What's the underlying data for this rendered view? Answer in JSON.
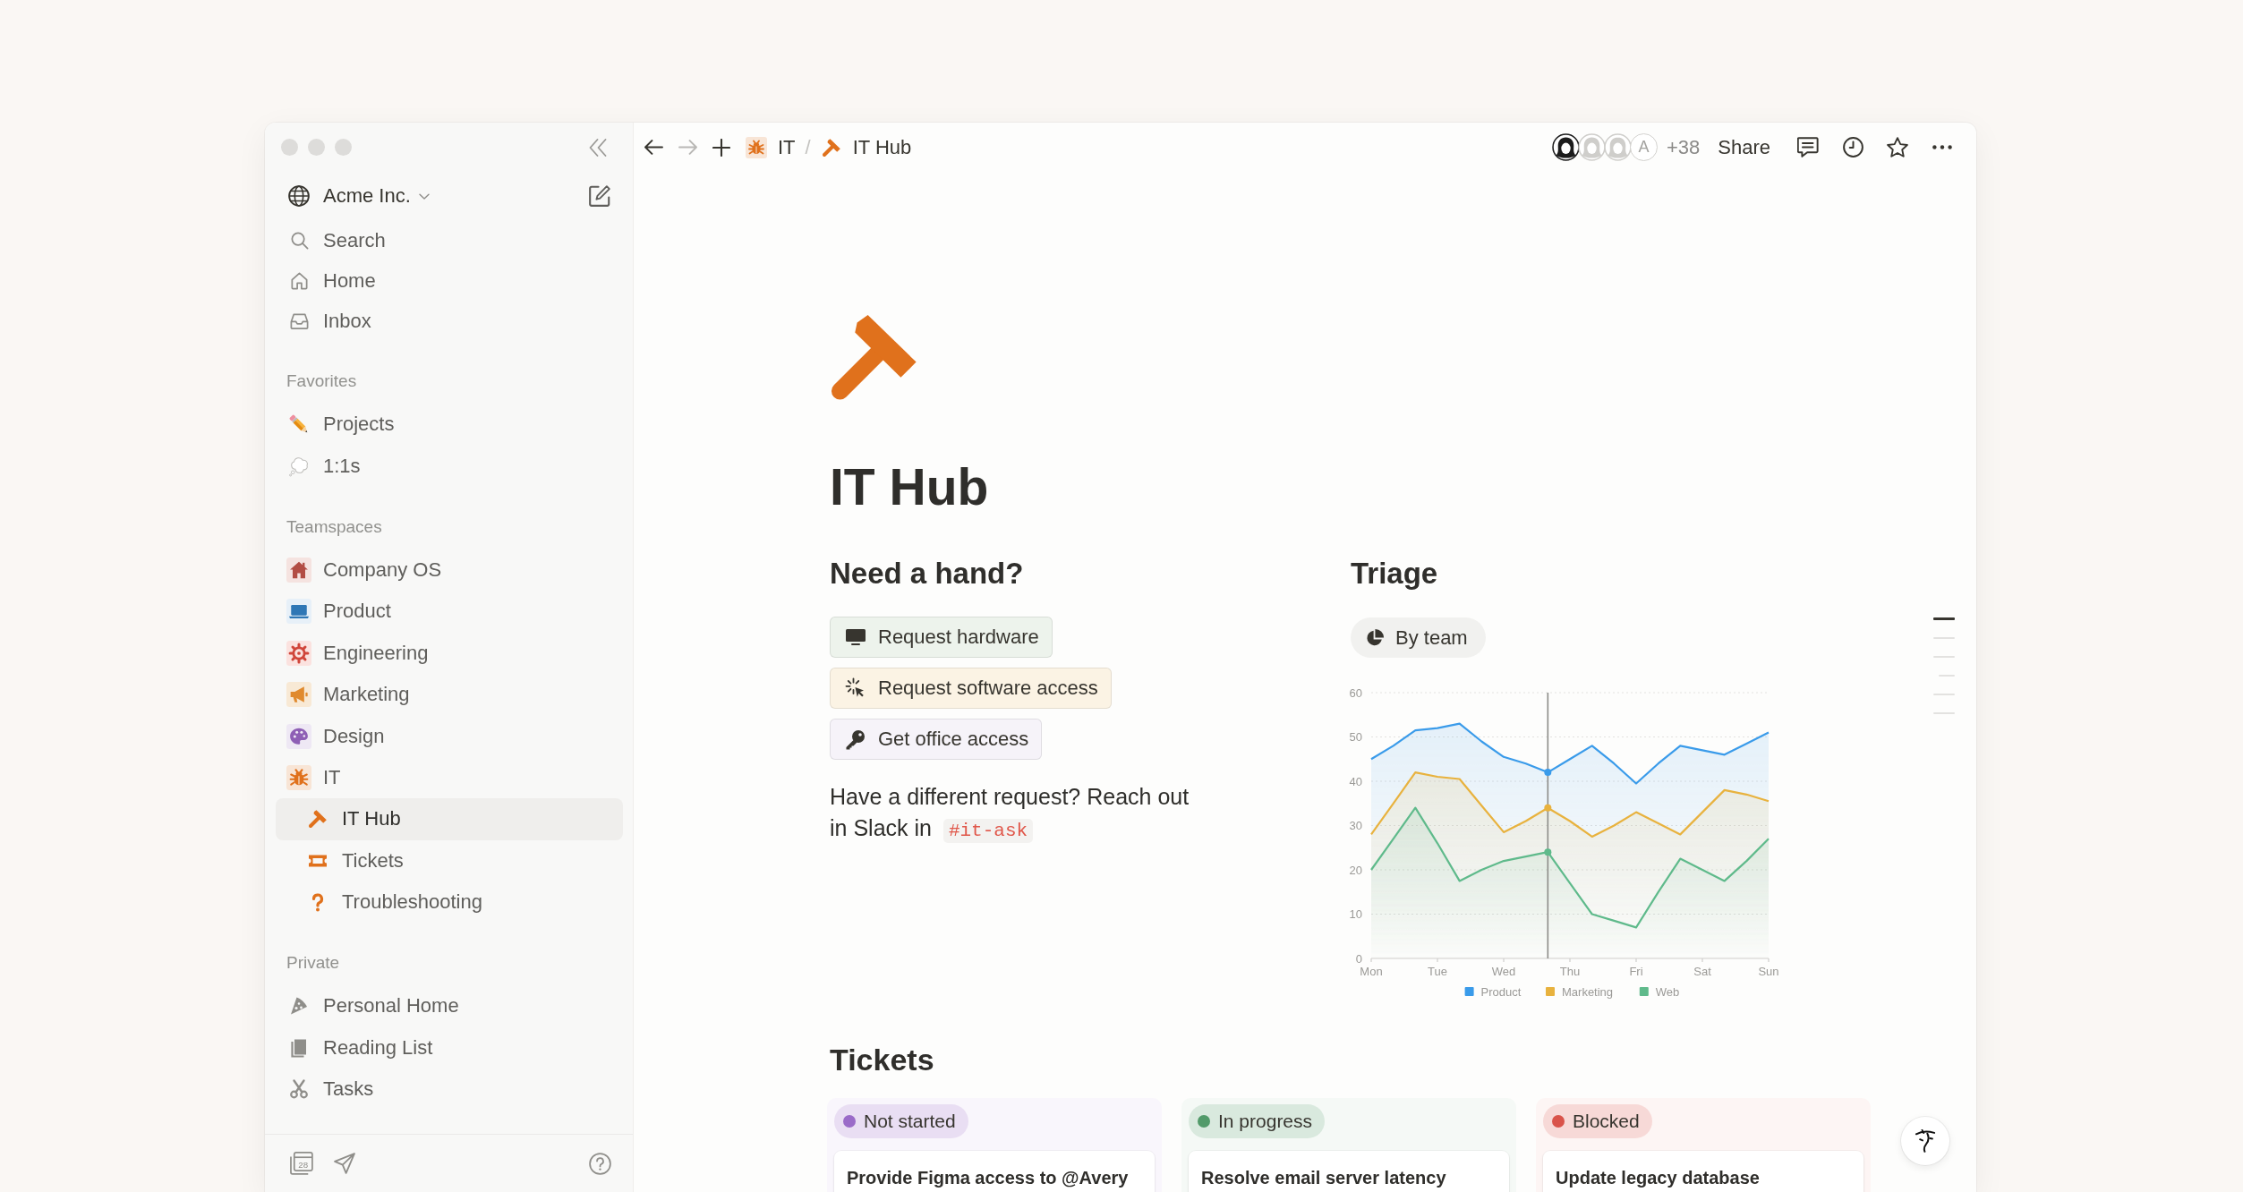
{
  "sidebar": {
    "workspace": "Acme Inc.",
    "nav": [
      {
        "kind": "search",
        "label": "Search"
      },
      {
        "kind": "home",
        "label": "Home"
      },
      {
        "kind": "inbox",
        "label": "Inbox"
      }
    ],
    "sections": [
      {
        "title": "Favorites",
        "items": [
          {
            "kind": "pencil",
            "label": "Projects",
            "selected": false
          },
          {
            "kind": "cloud",
            "label": "1:1s",
            "selected": false
          }
        ]
      },
      {
        "title": "Teamspaces",
        "items": [
          {
            "kind": "house",
            "label": "Company OS",
            "selected": false
          },
          {
            "kind": "laptop",
            "label": "Product",
            "selected": false
          },
          {
            "kind": "gear",
            "label": "Engineering",
            "selected": false
          },
          {
            "kind": "megaphone",
            "label": "Marketing",
            "selected": false
          },
          {
            "kind": "palette",
            "label": "Design",
            "selected": false
          },
          {
            "kind": "bug",
            "label": "IT",
            "selected": false,
            "children": [
              {
                "kind": "hammer",
                "label": "IT Hub",
                "selected": true
              },
              {
                "kind": "ticket",
                "label": "Tickets",
                "selected": false
              },
              {
                "kind": "question",
                "label": "Troubleshooting",
                "selected": false
              }
            ]
          }
        ]
      },
      {
        "title": "Private",
        "items": [
          {
            "kind": "pizza",
            "label": "Personal Home",
            "selected": false
          },
          {
            "kind": "book",
            "label": "Reading List",
            "selected": false
          },
          {
            "kind": "scissors",
            "label": "Tasks",
            "selected": false
          }
        ]
      }
    ],
    "footer": {
      "calendar_day": "28"
    }
  },
  "topbar": {
    "back_disabled": false,
    "forward_disabled": true,
    "breadcrumbs": [
      {
        "kind": "bug",
        "label": "IT"
      },
      {
        "kind": "hammer",
        "label": "IT Hub"
      }
    ],
    "separator": "/",
    "collaborators": [
      {
        "kind": "illustration",
        "active": true
      },
      {
        "kind": "illustration",
        "active": false
      },
      {
        "kind": "illustration",
        "active": false
      },
      {
        "kind": "initial",
        "initial": "A",
        "active": false
      }
    ],
    "extra_count": "+38",
    "share": "Share"
  },
  "page": {
    "title": "IT Hub",
    "help": {
      "heading": "Need a hand?",
      "buttons": [
        {
          "kind": "monitor",
          "label": "Request hardware",
          "color": "#edf3ec"
        },
        {
          "kind": "sparkle",
          "label": "Request software access",
          "color": "#fbf3e4"
        },
        {
          "kind": "key",
          "label": "Get office access",
          "color": "#f6f3f9"
        }
      ],
      "note": "Have a different request? Reach out in Slack in",
      "channel": "#it-ask"
    },
    "triage": {
      "heading": "Triage",
      "view": "By team",
      "chart_data": {
        "type": "area",
        "categories": [
          "Mon",
          null,
          null,
          "Tue",
          null,
          null,
          "Wed",
          null,
          null,
          "Thu",
          null,
          null,
          "Fri",
          null,
          null,
          "Sat",
          null,
          null,
          "Sun"
        ],
        "series": [
          {
            "name": "Product",
            "color": "#3a9bea",
            "values": [
              45,
              48,
              51.5,
              52,
              53,
              49,
              45.5,
              44,
              42,
              45,
              48,
              44,
              39.5,
              44,
              48,
              47,
              46,
              48.5,
              51
            ]
          },
          {
            "name": "Marketing",
            "color": "#e8b23e",
            "values": [
              28,
              35,
              42,
              41,
              40.5,
              34.5,
              28.5,
              31,
              34,
              31,
              27.5,
              30,
              33,
              30.5,
              28,
              33,
              38,
              37,
              35.5
            ]
          },
          {
            "name": "Web",
            "color": "#5fba8b",
            "values": [
              20,
              27,
              34,
              26,
              17.5,
              20,
              22,
              23,
              24,
              17,
              10,
              8.5,
              7,
              15,
              22.5,
              20,
              17.5,
              22,
              27
            ]
          }
        ],
        "ylim": [
          0,
          60
        ],
        "yticks": [
          0,
          10,
          20,
          30,
          40,
          50,
          60
        ],
        "stacked": false,
        "grid": true,
        "legend": "bottom"
      }
    },
    "tickets": {
      "heading": "Tickets",
      "columns": [
        {
          "status": "Not started",
          "color": "#9a6bc8",
          "cards": [
            {
              "title": "Provide Figma access to @Avery"
            }
          ]
        },
        {
          "status": "In progress",
          "color": "#529a6a",
          "cards": [
            {
              "title": "Resolve email server latency"
            }
          ]
        },
        {
          "status": "Blocked",
          "color": "#d9534a",
          "cards": [
            {
              "title": "Update legacy database"
            }
          ]
        }
      ]
    },
    "outline": [
      {
        "kind": "heading",
        "selected": true
      },
      {
        "kind": "heading",
        "selected": false
      },
      {
        "kind": "heading",
        "selected": false
      },
      {
        "kind": "subheading",
        "selected": false
      },
      {
        "kind": "heading",
        "selected": false
      },
      {
        "kind": "heading",
        "selected": false
      }
    ]
  }
}
